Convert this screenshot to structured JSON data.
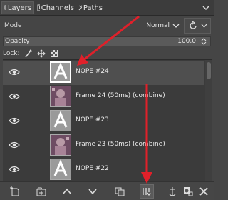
{
  "tabs": [
    {
      "label": "Layers",
      "icon": "layers-icon"
    },
    {
      "label": "Channels",
      "icon": "channels-icon"
    },
    {
      "label": "Paths",
      "icon": "paths-icon"
    }
  ],
  "mode": {
    "label": "Mode",
    "value": "Normal"
  },
  "opacity": {
    "label": "Opacity",
    "value": "100.0"
  },
  "lock": {
    "label": "Lock:"
  },
  "layers": [
    {
      "name": "NOPE #24",
      "type": "text",
      "visible": true,
      "selected": true
    },
    {
      "name": "Frame 24 (50ms) (combine)",
      "type": "frame",
      "visible": true,
      "selected": false
    },
    {
      "name": "NOPE #23",
      "type": "text",
      "visible": true,
      "selected": false
    },
    {
      "name": "Frame 23 (50ms) (combine)",
      "type": "frame",
      "visible": true,
      "selected": false
    },
    {
      "name": "NOPE #22",
      "type": "text",
      "visible": true,
      "selected": false
    }
  ],
  "footer_tools": [
    "new-layer-icon",
    "new-layer-group-icon",
    "raise-layer-icon",
    "lower-layer-icon",
    "duplicate-layer-icon",
    "merge-down-icon",
    "anchor-layer-icon",
    "mask-icon",
    "delete-layer-icon"
  ],
  "colors": {
    "background": "#454545",
    "list_bg": "#3b3b3b",
    "selected_row": "#4f4f4f",
    "annotation_arrow": "#e0202a"
  }
}
